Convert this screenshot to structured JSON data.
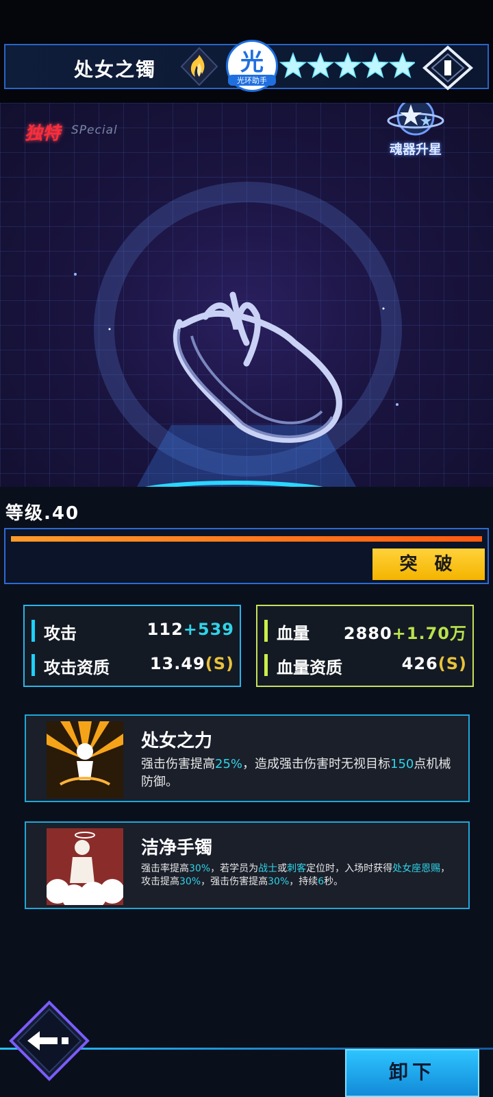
{
  "header": {
    "item_name": "处女之镯",
    "overlay_logo_char": "光",
    "overlay_logo_caption": "光环助手",
    "star_count": 5
  },
  "stage": {
    "rarity_badge": "独特",
    "rarity_en": "SPecial",
    "upgrade_label": "魂器升星"
  },
  "level": {
    "label": "等级.40",
    "exp_fraction": 1.0,
    "breakthrough_label": "突 破"
  },
  "stats": {
    "attack": {
      "label": "攻击",
      "base": "112",
      "bonus": "+539"
    },
    "attack_quality": {
      "label": "攻击资质",
      "value": "13.49",
      "grade": "(S)"
    },
    "hp": {
      "label": "血量",
      "base": "2880",
      "bonus": "+1.70万"
    },
    "hp_quality": {
      "label": "血量资质",
      "value": "426",
      "grade": "(S)"
    }
  },
  "skills": [
    {
      "title": "处女之力",
      "desc_parts": [
        "强击伤害提高",
        "25%",
        "，造成强击伤害时无视目标",
        "150",
        "点机械防御。"
      ]
    },
    {
      "title": "洁净手镯",
      "desc_parts": [
        "强击率提高",
        "30%",
        "，若学员为",
        "战士",
        "或",
        "刺客",
        "定位时，入场时获得",
        "处女座恩赐",
        "，攻击提高",
        "30%",
        "，强击伤害提高",
        "30%",
        "，持续",
        "6",
        "秒。"
      ]
    }
  ],
  "footer": {
    "unequip_label": "卸下"
  },
  "colors": {
    "accent_cyan": "#2fd4e8",
    "accent_green": "#b8e34c",
    "gold": "#f4b400",
    "exp_orange": "#ff7a1a"
  }
}
